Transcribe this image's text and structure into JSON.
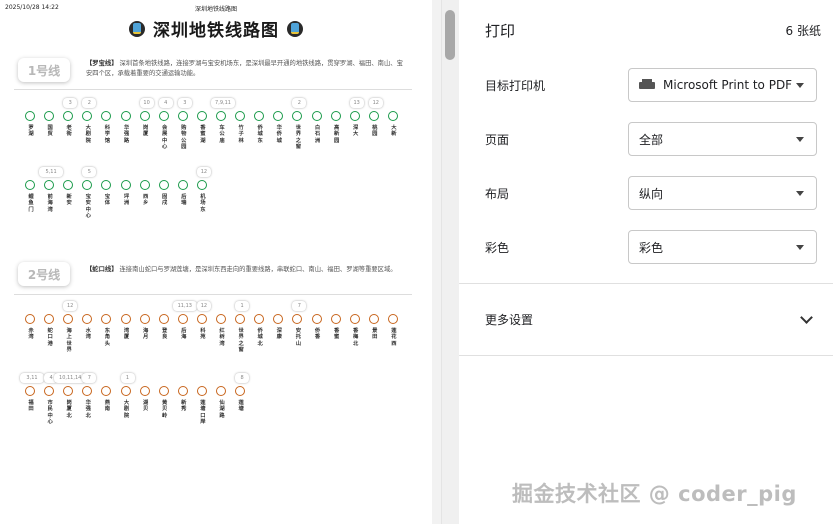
{
  "preview": {
    "header_date": "2025/10/28 14:22",
    "header_title": "深圳地铁线路图",
    "doc_title": "深圳地铁线路图",
    "lines": [
      {
        "badge": "1号线",
        "name": "【罗宝线】",
        "desc": "深圳首条地铁线路，连接罗湖与宝安机场东，是深圳最早开通的地铁线路，贯穿罗湖、福田、南山、宝安四个区，承载着重要的交通运输功能。",
        "color": "#1a9a4a",
        "rows": [
          [
            {
              "n": "罗湖",
              "t": ""
            },
            {
              "n": "国贸",
              "t": ""
            },
            {
              "n": "老街",
              "t": "3"
            },
            {
              "n": "大剧院",
              "t": "2"
            },
            {
              "n": "科学馆",
              "t": ""
            },
            {
              "n": "华强路",
              "t": ""
            },
            {
              "n": "岗厦",
              "t": "10"
            },
            {
              "n": "会展中心",
              "t": "4"
            },
            {
              "n": "购物公园",
              "t": "3"
            },
            {
              "n": "香蜜湖",
              "t": ""
            },
            {
              "n": "车公庙",
              "t": "7,9,11"
            },
            {
              "n": "竹子林",
              "t": ""
            },
            {
              "n": "侨城东",
              "t": ""
            },
            {
              "n": "华侨城",
              "t": ""
            },
            {
              "n": "世界之窗",
              "t": "2"
            },
            {
              "n": "白石洲",
              "t": ""
            },
            {
              "n": "高新园",
              "t": ""
            },
            {
              "n": "深大",
              "t": "13"
            },
            {
              "n": "桃园",
              "t": "12"
            },
            {
              "n": "大新",
              "t": ""
            }
          ],
          [
            {
              "n": "鲤鱼门",
              "t": ""
            },
            {
              "n": "前海湾",
              "t": "5,11"
            },
            {
              "n": "新安",
              "t": ""
            },
            {
              "n": "宝安中心",
              "t": "5"
            },
            {
              "n": "宝体",
              "t": ""
            },
            {
              "n": "坪洲",
              "t": ""
            },
            {
              "n": "西乡",
              "t": ""
            },
            {
              "n": "固戍",
              "t": ""
            },
            {
              "n": "后瑞",
              "t": ""
            },
            {
              "n": "机场东",
              "t": "12"
            }
          ]
        ]
      },
      {
        "badge": "2号线",
        "name": "【蛇口线】",
        "desc": "连接南山蛇口与罗湖莲塘，是深圳东西走向的重要线路，串联蛇口、南山、福田、罗湖等重要区域。",
        "color": "#c8661e",
        "rows": [
          [
            {
              "n": "赤湾",
              "t": ""
            },
            {
              "n": "蛇口港",
              "t": ""
            },
            {
              "n": "海上世界",
              "t": "12"
            },
            {
              "n": "水湾",
              "t": ""
            },
            {
              "n": "东角头",
              "t": ""
            },
            {
              "n": "湾厦",
              "t": ""
            },
            {
              "n": "海月",
              "t": ""
            },
            {
              "n": "登良",
              "t": ""
            },
            {
              "n": "后海",
              "t": "11,13"
            },
            {
              "n": "科苑",
              "t": "12"
            },
            {
              "n": "红树湾",
              "t": ""
            },
            {
              "n": "世界之窗",
              "t": "1"
            },
            {
              "n": "侨城北",
              "t": ""
            },
            {
              "n": "深康",
              "t": ""
            },
            {
              "n": "安托山",
              "t": "7"
            },
            {
              "n": "侨香",
              "t": ""
            },
            {
              "n": "香蜜",
              "t": ""
            },
            {
              "n": "香梅北",
              "t": ""
            },
            {
              "n": "景田",
              "t": ""
            },
            {
              "n": "莲花西",
              "t": ""
            }
          ],
          [
            {
              "n": "福田",
              "t": "3,11"
            },
            {
              "n": "市民中心",
              "t": "4"
            },
            {
              "n": "岗厦北",
              "t": "10,11,14"
            },
            {
              "n": "华强北",
              "t": "7"
            },
            {
              "n": "燕南",
              "t": ""
            },
            {
              "n": "大剧院",
              "t": "1"
            },
            {
              "n": "湖贝",
              "t": ""
            },
            {
              "n": "黄贝岭",
              "t": ""
            },
            {
              "n": "新秀",
              "t": ""
            },
            {
              "n": "莲塘口岸",
              "t": ""
            },
            {
              "n": "仙湖路",
              "t": ""
            },
            {
              "n": "莲塘",
              "t": "8"
            }
          ]
        ]
      }
    ]
  },
  "print_panel": {
    "title": "打印",
    "sheet_count": "6 张纸",
    "rows": [
      {
        "label": "目标打印机",
        "value": "Microsoft Print to PDF"
      },
      {
        "label": "页面",
        "value": "全部"
      },
      {
        "label": "布局",
        "value": "纵向"
      },
      {
        "label": "彩色",
        "value": "彩色"
      }
    ],
    "more_settings": "更多设置"
  },
  "watermark": "掘金技术社区 @ coder_pig"
}
